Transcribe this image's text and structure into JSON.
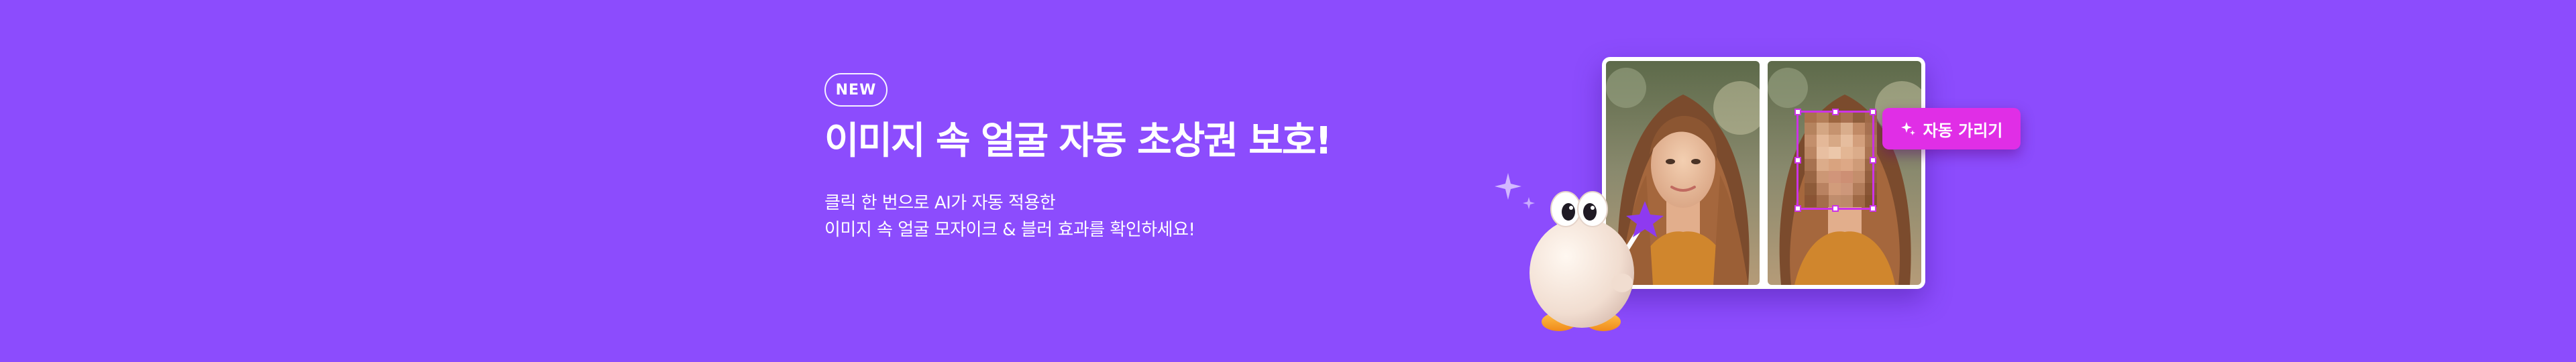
{
  "theme": {
    "background": "#8c4cfd",
    "accent": "#e02ee6"
  },
  "banner": {
    "badge": "NEW",
    "title": "이미지 속 얼굴 자동 초상권 보호!",
    "description": [
      "클릭 한 번으로 AI가 자동 적용한",
      "이미지 속 얼굴 모자이크 & 블러 효과를 확인하세요!"
    ]
  },
  "demo": {
    "action_button": {
      "label": "자동 가리기",
      "icon": "sparkle-icon"
    }
  }
}
